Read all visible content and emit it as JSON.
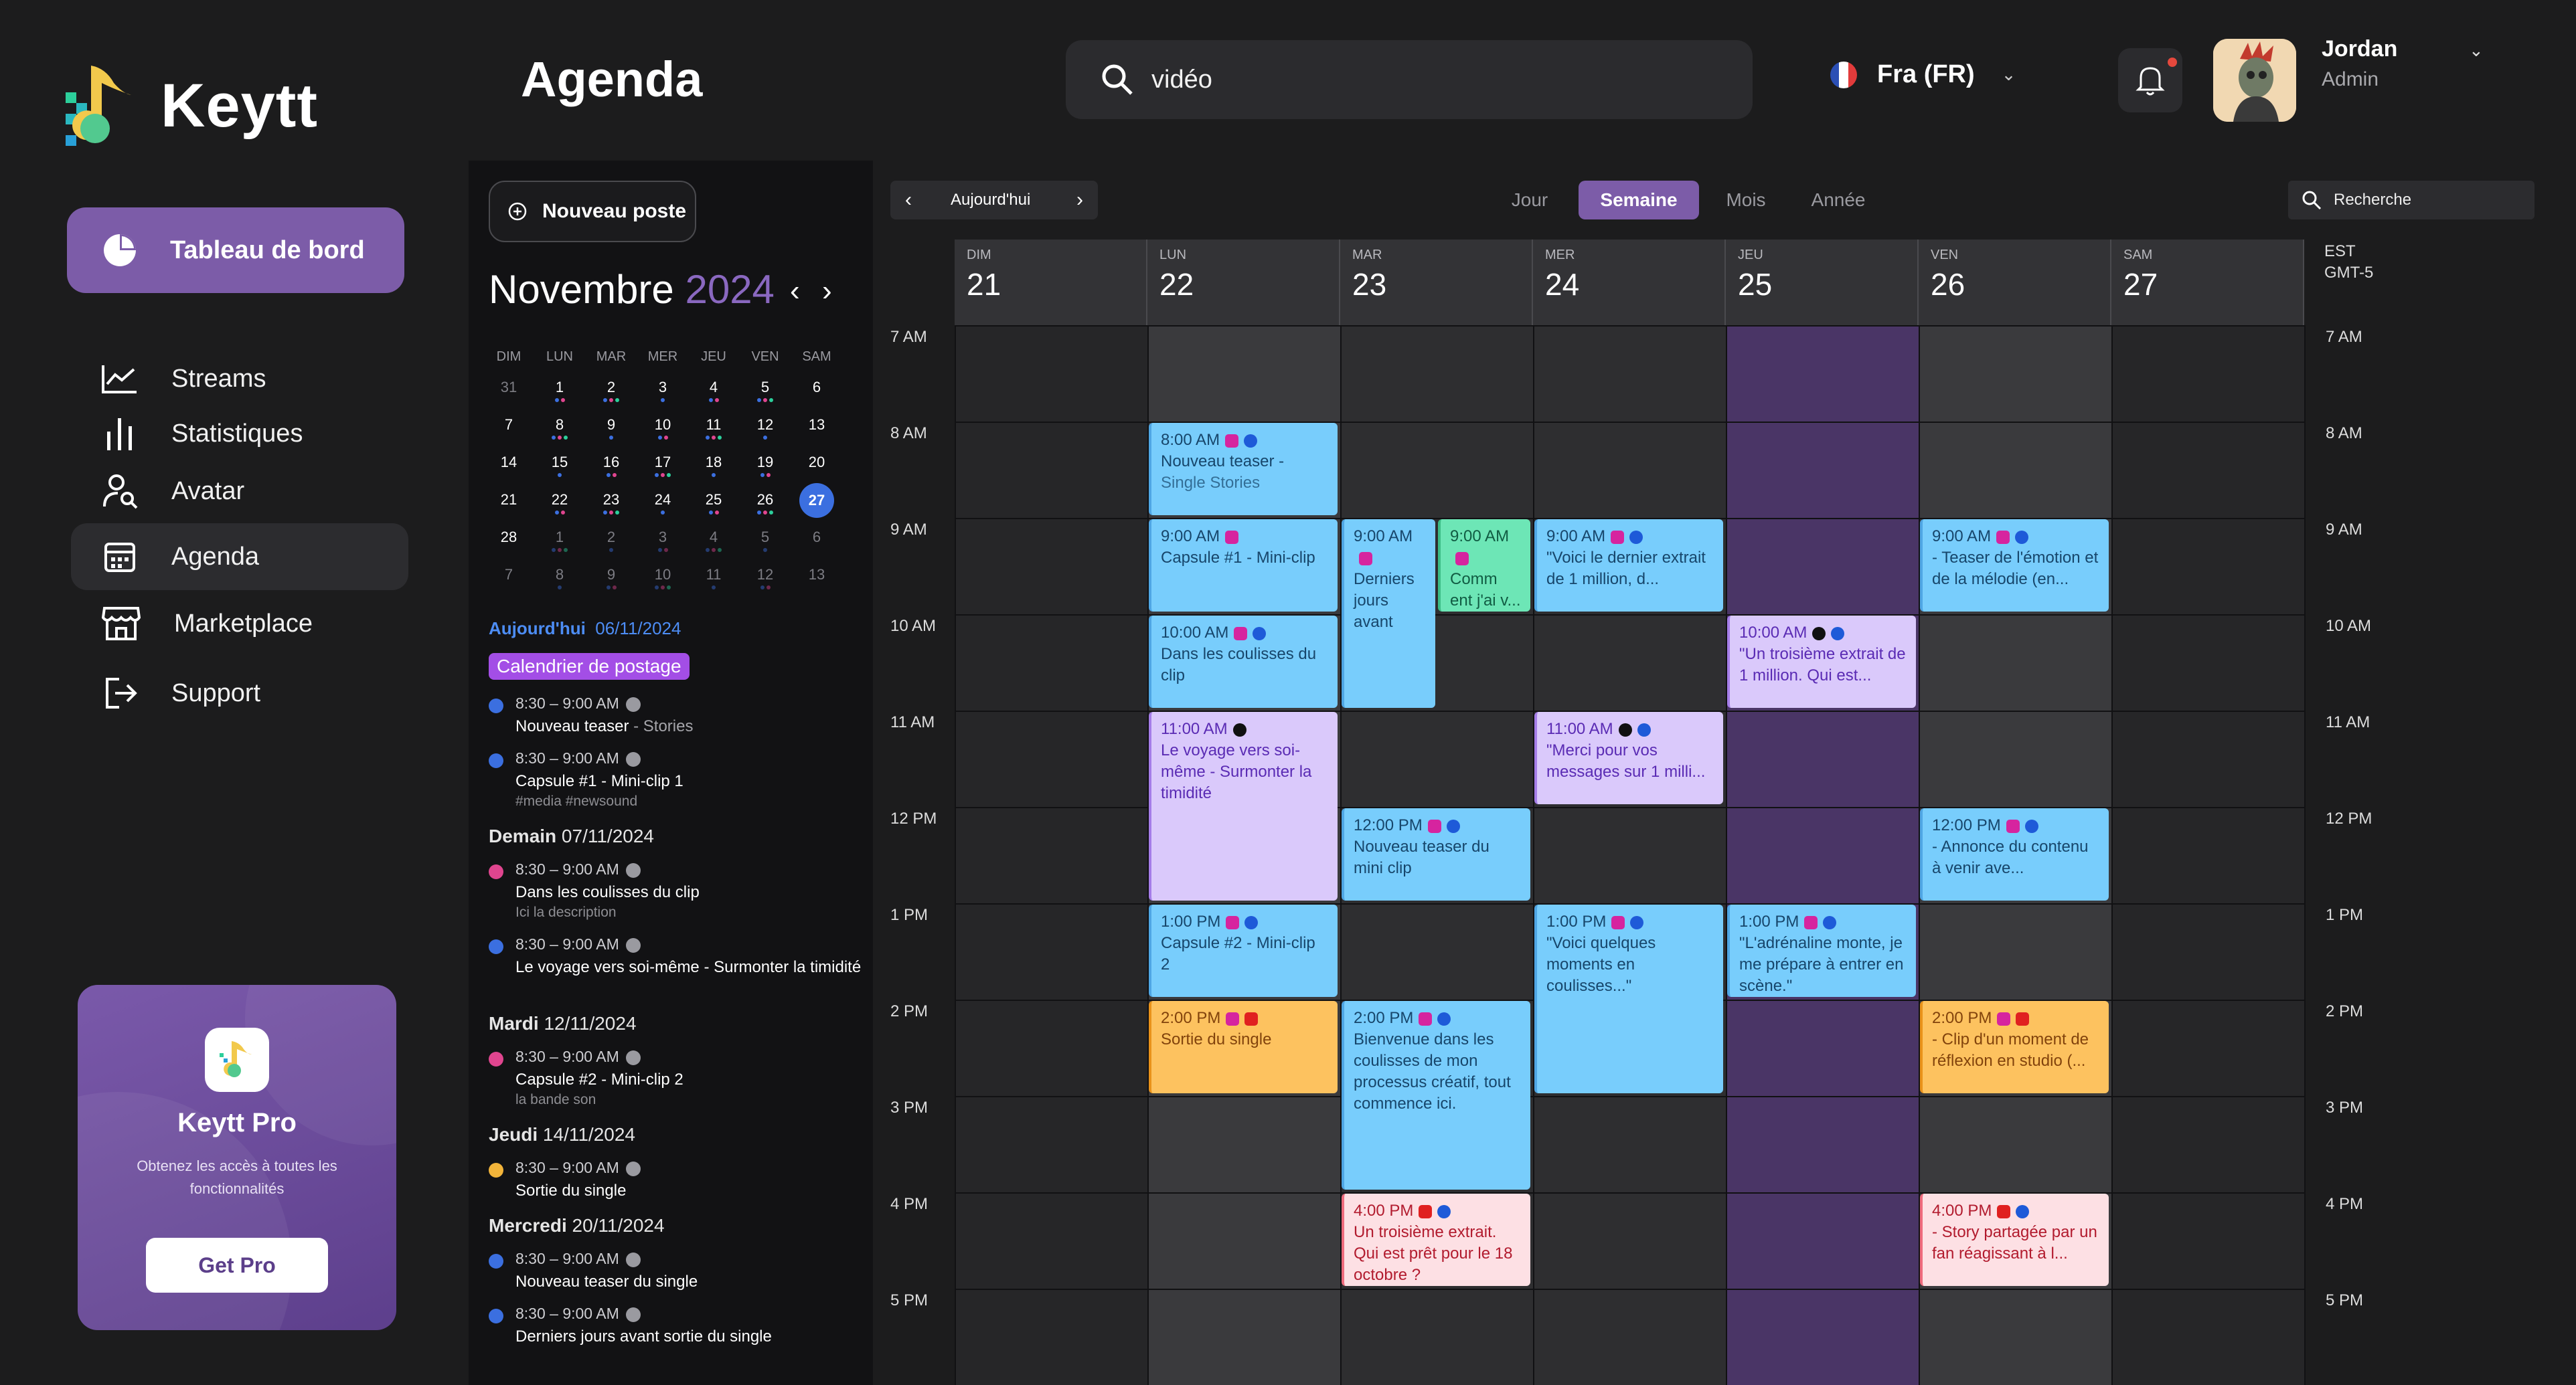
{
  "app": {
    "name": "Keytt"
  },
  "sidebar": {
    "primary": "Tableau de bord",
    "items": [
      {
        "label": "Streams",
        "icon": "chart-line-icon"
      },
      {
        "label": "Statistiques",
        "icon": "bar-stats-icon"
      },
      {
        "label": "Avatar",
        "icon": "user-search-icon"
      },
      {
        "label": "Agenda",
        "icon": "calendar-icon"
      },
      {
        "label": "Marketplace",
        "icon": "store-icon"
      },
      {
        "label": "Support",
        "icon": "logout-icon"
      }
    ],
    "pro": {
      "title": "Keytt Pro",
      "subtitle": "Obtenez les accès à toutes les fonctionnalités",
      "button": "Get Pro"
    }
  },
  "topbar": {
    "title": "Agenda",
    "search_value": "vidéo",
    "language": "Fra (FR)",
    "user_name": "Jordan",
    "user_role": "Admin"
  },
  "mini": {
    "new_post": "Nouveau poste",
    "month": "Novembre",
    "year": "2024",
    "dow": [
      "DIM",
      "LUN",
      "MAR",
      "MER",
      "JEU",
      "VEN",
      "SAM"
    ],
    "weeks": [
      [
        "31",
        "1",
        "2",
        "3",
        "4",
        "5",
        "6"
      ],
      [
        "7",
        "8",
        "9",
        "10",
        "11",
        "12",
        "13"
      ],
      [
        "14",
        "15",
        "16",
        "17",
        "18",
        "19",
        "20"
      ],
      [
        "21",
        "22",
        "23",
        "24",
        "25",
        "26",
        "27"
      ],
      [
        "28",
        "1",
        "2",
        "3",
        "4",
        "5",
        "6"
      ],
      [
        "7",
        "8",
        "9",
        "10",
        "11",
        "12",
        "13"
      ]
    ],
    "today_label": "Aujourd'hui",
    "today_date": "06/11/2024",
    "tag": "Calendrier de postage",
    "groups": [
      {
        "day": "",
        "date": "",
        "events": [
          {
            "time": "8:30 – 9:00 AM",
            "title": "Nouveau teaser",
            "sub": " - Stories",
            "desc": "",
            "color": "#3b6fe0"
          },
          {
            "time": "8:30 – 9:00 AM",
            "title": "Capsule #1 - Mini-clip 1",
            "sub": "",
            "desc": "#media #newsound",
            "color": "#3b6fe0"
          }
        ]
      },
      {
        "day": "Demain",
        "date": "07/11/2024",
        "events": [
          {
            "time": "8:30 – 9:00 AM",
            "title": "Dans les coulisses du clip",
            "sub": "",
            "desc": "Ici la description",
            "color": "#e0458f"
          },
          {
            "time": "8:30 – 9:00 AM",
            "title": "Le voyage vers soi-même - Surmonter la timidité",
            "sub": "",
            "desc": "",
            "color": "#3b6fe0"
          }
        ]
      },
      {
        "day": "Mardi",
        "date": "12/11/2024",
        "events": [
          {
            "time": "8:30 – 9:00 AM",
            "title": "Capsule #2 - Mini-clip 2",
            "sub": "",
            "desc": "la bande son",
            "color": "#e0458f"
          }
        ]
      },
      {
        "day": "Jeudi",
        "date": "14/11/2024",
        "events": [
          {
            "time": "8:30 – 9:00 AM",
            "title": "Sortie du single",
            "sub": "",
            "desc": "",
            "color": "#f2b43a"
          }
        ]
      },
      {
        "day": "Mercredi",
        "date": "20/11/2024",
        "events": [
          {
            "time": "8:30 – 9:00 AM",
            "title": "Nouveau teaser du single",
            "sub": "",
            "desc": "",
            "color": "#3b6fe0"
          },
          {
            "time": "8:30 – 9:00 AM",
            "title": "Derniers jours avant sortie du single",
            "sub": "",
            "desc": "",
            "color": "#3b6fe0"
          }
        ]
      }
    ]
  },
  "week": {
    "today_button": "Aujourd'hui",
    "views": [
      "Jour",
      "Semaine",
      "Mois",
      "Année"
    ],
    "active_view": "Semaine",
    "search_placeholder": "Recherche",
    "timezone": [
      "EST",
      "GMT-5"
    ],
    "days": [
      {
        "dow": "DIM",
        "num": "21"
      },
      {
        "dow": "LUN",
        "num": "22"
      },
      {
        "dow": "MAR",
        "num": "23"
      },
      {
        "dow": "MER",
        "num": "24"
      },
      {
        "dow": "JEU",
        "num": "25"
      },
      {
        "dow": "VEN",
        "num": "26"
      },
      {
        "dow": "SAM",
        "num": "27"
      }
    ],
    "hours": [
      "7 AM",
      "8 AM",
      "9 AM",
      "10 AM",
      "11 AM",
      "12 PM",
      "1 PM",
      "2 PM",
      "3 PM",
      "4 PM",
      "5 PM"
    ],
    "events": [
      {
        "day": 1,
        "start": 8,
        "end": 9,
        "time": "8:00 AM",
        "title": "Nouveau teaser - ",
        "sub": "Single Stories",
        "color": "blue",
        "icons": [
          "instagram",
          "pinterest"
        ]
      },
      {
        "day": 1,
        "start": 9,
        "end": 10,
        "time": "9:00 AM",
        "title": "Capsule #1 - Mini-clip",
        "sub": "",
        "color": "blue",
        "icons": [
          "instagram"
        ]
      },
      {
        "day": 1,
        "start": 10,
        "end": 11,
        "time": "10:00 AM",
        "title": "Dans les coulisses du clip",
        "sub": "",
        "color": "blue",
        "icons": [
          "instagram",
          "pinterest"
        ]
      },
      {
        "day": 1,
        "start": 11,
        "end": 13,
        "time": "11:00 AM",
        "title": "Le voyage vers soi-même - Surmonter la timidité",
        "sub": "",
        "color": "lav",
        "icons": [
          "tiktok"
        ]
      },
      {
        "day": 1,
        "start": 13,
        "end": 14,
        "time": "1:00 PM",
        "title": "Capsule #2 - Mini-clip 2",
        "sub": "",
        "color": "blue",
        "icons": [
          "instagram",
          "pinterest"
        ]
      },
      {
        "day": 1,
        "start": 14,
        "end": 15,
        "time": "2:00 PM",
        "title": "Sortie du single",
        "sub": "",
        "color": "orange",
        "icons": [
          "instagram",
          "youtube"
        ]
      },
      {
        "day": 2,
        "start": 9,
        "end": 11,
        "half": "left",
        "time": "9:00 AM",
        "title": "Derniers jours avant",
        "sub": "",
        "color": "blue",
        "icons": [
          "instagram"
        ]
      },
      {
        "day": 2,
        "start": 9,
        "end": 10,
        "half": "right",
        "time": "9:00 AM",
        "title": "Comm ent j'ai v...",
        "sub": "",
        "color": "green",
        "icons": [
          "instagram"
        ]
      },
      {
        "day": 2,
        "start": 12,
        "end": 13,
        "time": "12:00 PM",
        "title": "Nouveau teaser du mini clip",
        "sub": "",
        "color": "blue",
        "icons": [
          "instagram",
          "pinterest"
        ]
      },
      {
        "day": 2,
        "start": 14,
        "end": 16,
        "time": "2:00 PM",
        "title": "Bienvenue dans les coulisses de mon processus créatif, tout commence ici.",
        "sub": "",
        "color": "blue",
        "icons": [
          "instagram",
          "pinterest"
        ]
      },
      {
        "day": 2,
        "start": 16,
        "end": 17,
        "time": "4:00 PM",
        "title": "Un troisième extrait. Qui est prêt pour le 18 octobre ?",
        "sub": "",
        "color": "pink",
        "icons": [
          "youtube",
          "pinterest"
        ]
      },
      {
        "day": 3,
        "start": 9,
        "end": 10,
        "time": "9:00 AM",
        "title": "\"Voici le dernier extrait de 1 million, d...",
        "sub": "",
        "color": "blue",
        "icons": [
          "instagram",
          "pinterest"
        ]
      },
      {
        "day": 3,
        "start": 11,
        "end": 12,
        "time": "11:00 AM",
        "title": "\"Merci pour vos messages sur 1 milli...",
        "sub": "",
        "color": "lav",
        "icons": [
          "tiktok",
          "pinterest"
        ]
      },
      {
        "day": 3,
        "start": 13,
        "end": 15,
        "time": "1:00 PM",
        "title": "\"Voici quelques moments en coulisses...\"",
        "sub": "",
        "color": "blue",
        "icons": [
          "instagram",
          "pinterest"
        ]
      },
      {
        "day": 4,
        "start": 10,
        "end": 11,
        "time": "10:00 AM",
        "title": "\"Un troisième extrait de 1 million. Qui est...",
        "sub": "",
        "color": "lav",
        "icons": [
          "tiktok",
          "pinterest"
        ]
      },
      {
        "day": 4,
        "start": 13,
        "end": 14,
        "time": "1:00 PM",
        "title": "\"L'adrénaline monte, je me prépare à entrer en scène.\"",
        "sub": "",
        "color": "blue",
        "icons": [
          "instagram",
          "pinterest"
        ]
      },
      {
        "day": 5,
        "start": 9,
        "end": 10,
        "time": "9:00 AM",
        "title": "- Teaser de l'émotion et de la mélodie (en...",
        "sub": "",
        "color": "blue",
        "icons": [
          "instagram",
          "pinterest"
        ]
      },
      {
        "day": 5,
        "start": 12,
        "end": 13,
        "time": "12:00 PM",
        "title": "- Annonce du contenu à venir ave...",
        "sub": "",
        "color": "blue",
        "icons": [
          "instagram",
          "pinterest"
        ]
      },
      {
        "day": 5,
        "start": 14,
        "end": 15,
        "time": "2:00 PM",
        "title": "- Clip d'un moment de réflexion en studio (...",
        "sub": "",
        "color": "orange",
        "icons": [
          "instagram",
          "youtube"
        ]
      },
      {
        "day": 5,
        "start": 16,
        "end": 17,
        "time": "4:00 PM",
        "title": "- Story partagée par un fan réagissant à l...",
        "sub": "",
        "color": "pink",
        "icons": [
          "youtube",
          "pinterest"
        ]
      }
    ]
  },
  "colors": {
    "accent": "#7c5ca8",
    "highlight_column": "#4a3566",
    "blue_event": "#78cdfc",
    "lavender_event": "#dac9fb",
    "orange_event": "#fdc25f",
    "pink_event": "#fde0e4",
    "green_event": "#6de6b6"
  }
}
